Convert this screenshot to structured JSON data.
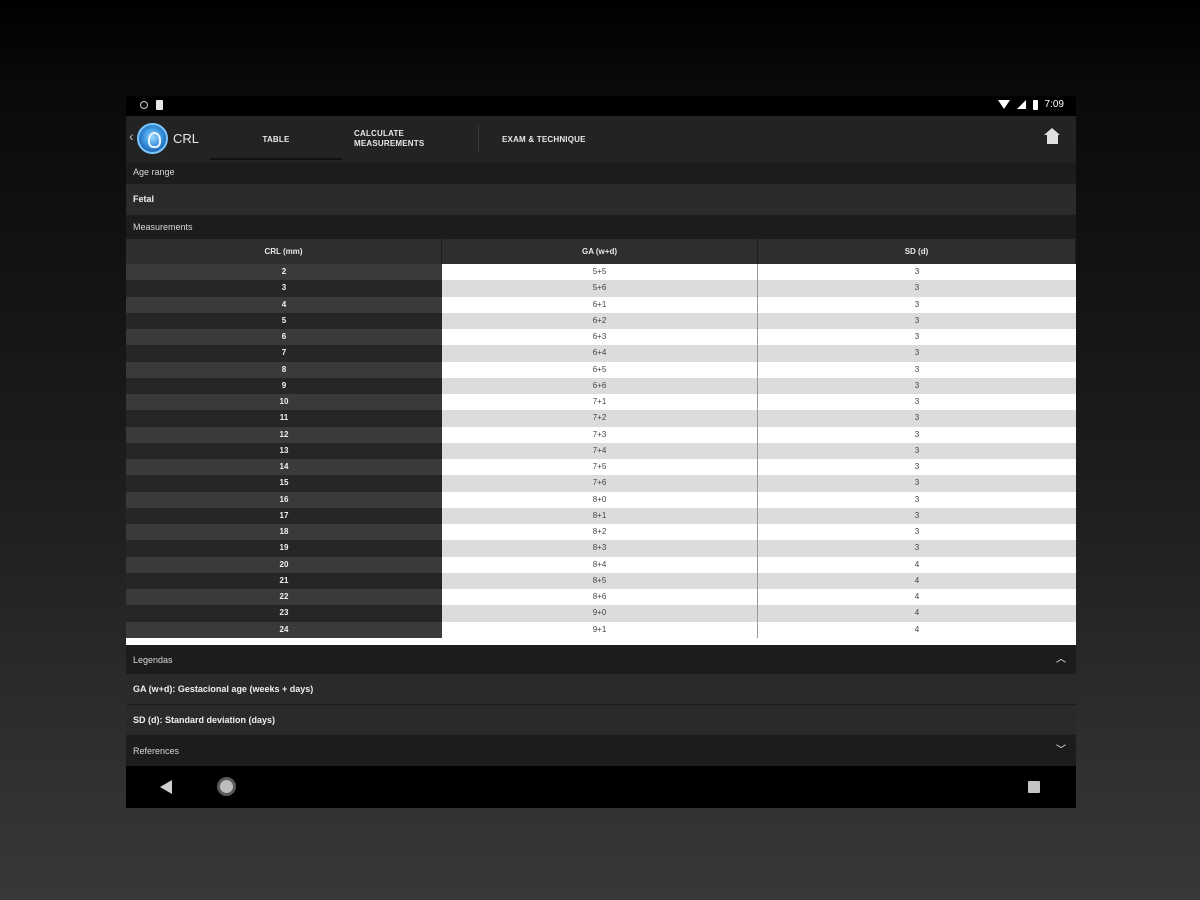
{
  "status_bar": {
    "time": "7:09"
  },
  "app_bar": {
    "title": "CRL",
    "tabs": [
      {
        "label": "TABLE"
      },
      {
        "label": "CALCULATE MEASUREMENTS"
      },
      {
        "label": "EXAM & TECHNIQUE"
      }
    ],
    "active_tab": "TABLE"
  },
  "age_range": {
    "label": "Age range",
    "value": "Fetal"
  },
  "measurements": {
    "label": "Measurements",
    "columns": [
      "CRL (mm)",
      "GA (w+d)",
      "SD (d)"
    ],
    "rows": [
      [
        "2",
        "5+5",
        "3"
      ],
      [
        "3",
        "5+6",
        "3"
      ],
      [
        "4",
        "6+1",
        "3"
      ],
      [
        "5",
        "6+2",
        "3"
      ],
      [
        "6",
        "6+3",
        "3"
      ],
      [
        "7",
        "6+4",
        "3"
      ],
      [
        "8",
        "6+5",
        "3"
      ],
      [
        "9",
        "6+6",
        "3"
      ],
      [
        "10",
        "7+1",
        "3"
      ],
      [
        "11",
        "7+2",
        "3"
      ],
      [
        "12",
        "7+3",
        "3"
      ],
      [
        "13",
        "7+4",
        "3"
      ],
      [
        "14",
        "7+5",
        "3"
      ],
      [
        "15",
        "7+6",
        "3"
      ],
      [
        "16",
        "8+0",
        "3"
      ],
      [
        "17",
        "8+1",
        "3"
      ],
      [
        "18",
        "8+2",
        "3"
      ],
      [
        "19",
        "8+3",
        "3"
      ],
      [
        "20",
        "8+4",
        "4"
      ],
      [
        "21",
        "8+5",
        "4"
      ],
      [
        "22",
        "8+6",
        "4"
      ],
      [
        "23",
        "9+0",
        "4"
      ],
      [
        "24",
        "9+1",
        "4"
      ]
    ]
  },
  "legends": {
    "label": "Legendas",
    "items": [
      "GA (w+d): Gestacional age (weeks + days)",
      "SD (d): Standard deviation (days)"
    ]
  },
  "references": {
    "label": "References"
  },
  "icons": {
    "home": "home-icon",
    "expand_less": "chevron-up-icon",
    "expand_more": "chevron-down-icon"
  }
}
